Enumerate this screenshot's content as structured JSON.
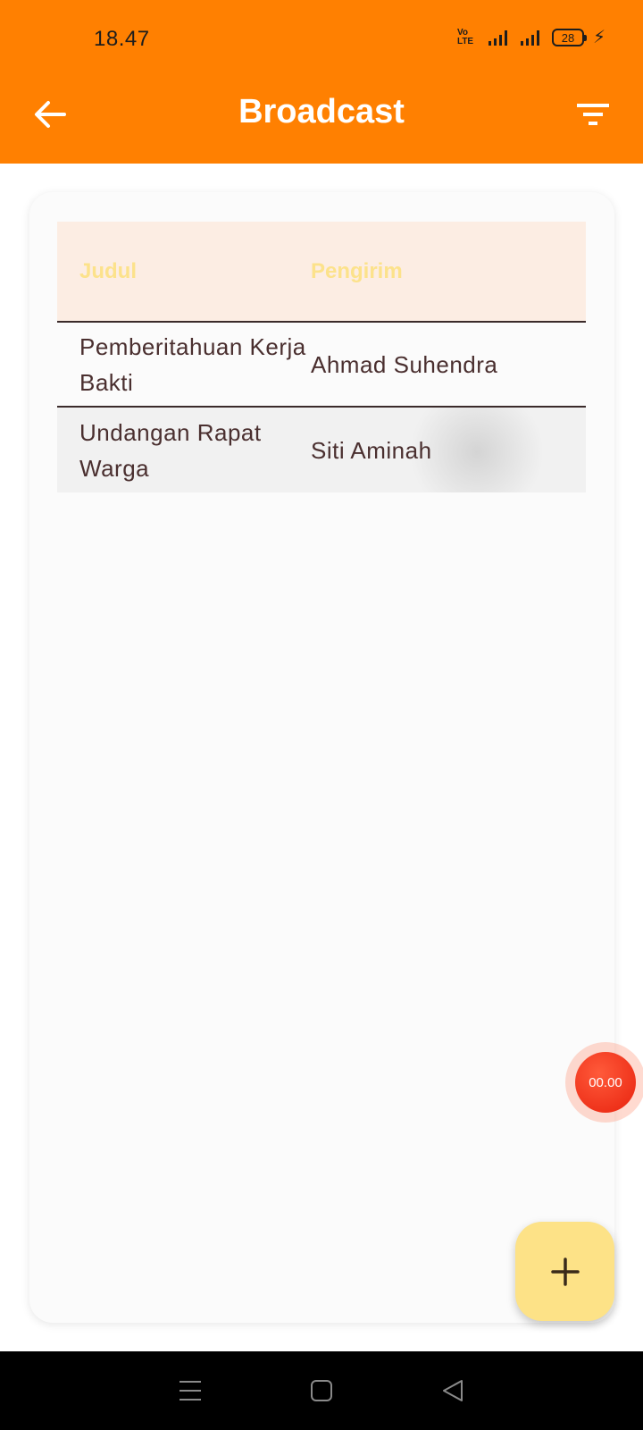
{
  "status_bar": {
    "time": "18.47",
    "volte_label": "Vo LTE",
    "battery_level": "28"
  },
  "app_bar": {
    "title": "Broadcast",
    "back_icon": "arrow-left-icon",
    "filter_icon": "filter-icon",
    "background_color": "#FF8001"
  },
  "table": {
    "headers": [
      "Judul",
      "Pengirim"
    ],
    "rows": [
      {
        "judul": "Pemberitahuan Kerja Bakti",
        "pengirim": "Ahmad Suhendra"
      },
      {
        "judul": "Undangan Rapat Warga",
        "pengirim": "Siti Aminah"
      }
    ],
    "header_text_color": "#FCE28B",
    "header_background": "#FCEDE3"
  },
  "timer_bubble": {
    "label": "00.00"
  },
  "fab": {
    "icon": "plus-icon",
    "color": "#FDE287"
  },
  "nav_bar": {
    "icons": [
      "menu-icon",
      "home-square-icon",
      "back-triangle-icon"
    ]
  }
}
